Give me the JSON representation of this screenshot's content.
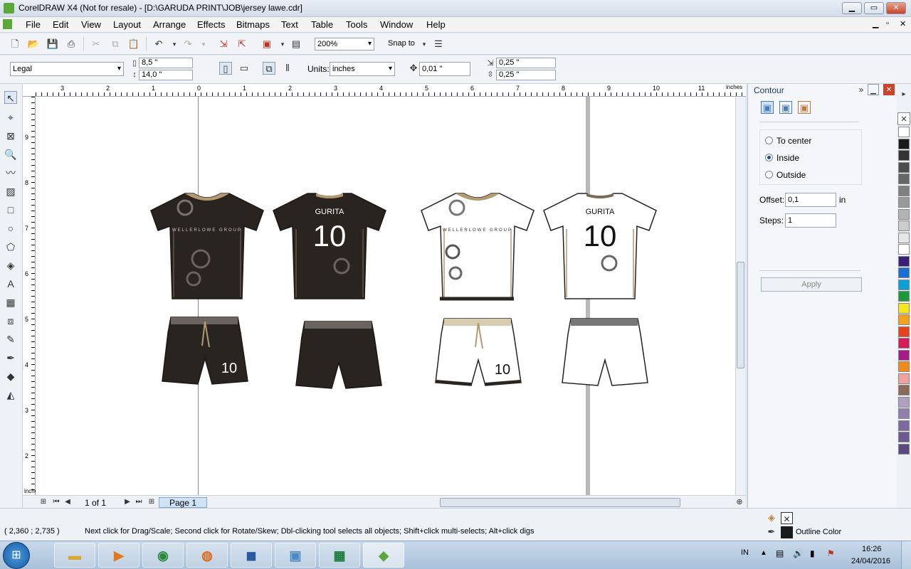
{
  "window": {
    "title": "CorelDRAW X4 (Not for resale) - [D:\\GARUDA PRINT\\JOB\\jersey lawe.cdr]"
  },
  "menu": [
    "File",
    "Edit",
    "View",
    "Layout",
    "Arrange",
    "Effects",
    "Bitmaps",
    "Text",
    "Table",
    "Tools",
    "Window",
    "Help"
  ],
  "standard_toolbar": {
    "zoom": "200%",
    "snap_to": "Snap to"
  },
  "property_bar": {
    "page_size": "Legal",
    "width": "8,5 \"",
    "height": "14,0 \"",
    "units_label": "Units:",
    "units": "inches",
    "nudge": "0,01 \"",
    "dup_x": "0,25 \"",
    "dup_y": "0,25 \""
  },
  "ruler": {
    "units": "inches",
    "h_ticks": [
      "3",
      "2",
      "1",
      "0",
      "1",
      "2",
      "3",
      "4",
      "5",
      "6",
      "7",
      "8",
      "9",
      "10",
      "11"
    ],
    "v_ticks": [
      "9",
      "8",
      "7",
      "6",
      "5",
      "4",
      "3",
      "2",
      "inches"
    ]
  },
  "design": {
    "player_name": "GURITA",
    "number": "10",
    "logo_text": "WELLERLOWE GROUP",
    "colors": {
      "dark": "#2a2420",
      "trim": "#b39a72",
      "light": "#ffffff"
    }
  },
  "page_nav": {
    "counter": "1 of 1",
    "tab": "Page 1"
  },
  "docker": {
    "title": "Contour",
    "options": [
      {
        "label": "To center",
        "selected": false
      },
      {
        "label": "Inside",
        "selected": true
      },
      {
        "label": "Outside",
        "selected": false
      }
    ],
    "offset_label": "Offset:",
    "offset_value": "0,1",
    "offset_unit": "in",
    "steps_label": "Steps:",
    "steps_value": "1",
    "apply": "Apply"
  },
  "palette": [
    "#ffffff",
    "#1a1a1a",
    "#333333",
    "#4d4d4d",
    "#666666",
    "#808080",
    "#999999",
    "#b3b3b3",
    "#cccccc",
    "#e6e6e6",
    "#ffffff",
    "#3a1f7a",
    "#1a6fd6",
    "#0ca0d8",
    "#1a9a3a",
    "#f6e71a",
    "#f5a21a",
    "#e8421a",
    "#d61a5a",
    "#a81a8a",
    "#f08a1a",
    "#f2a0a0",
    "#8a6a5a",
    "#b0a0c0",
    "#9080b0",
    "#7a6aa0",
    "#6a5a90",
    "#5a4a80"
  ],
  "status": {
    "coords": "( 2,360 ; 2,735 )",
    "hint": "Next click for Drag/Scale; Second click for Rotate/Skew; Dbl-clicking tool selects all objects; Shift+click multi-selects; Alt+click digs",
    "outline_label": "Outline Color"
  },
  "taskbar": {
    "lang": "IN",
    "time": "16:26",
    "date": "24/04/2016"
  }
}
